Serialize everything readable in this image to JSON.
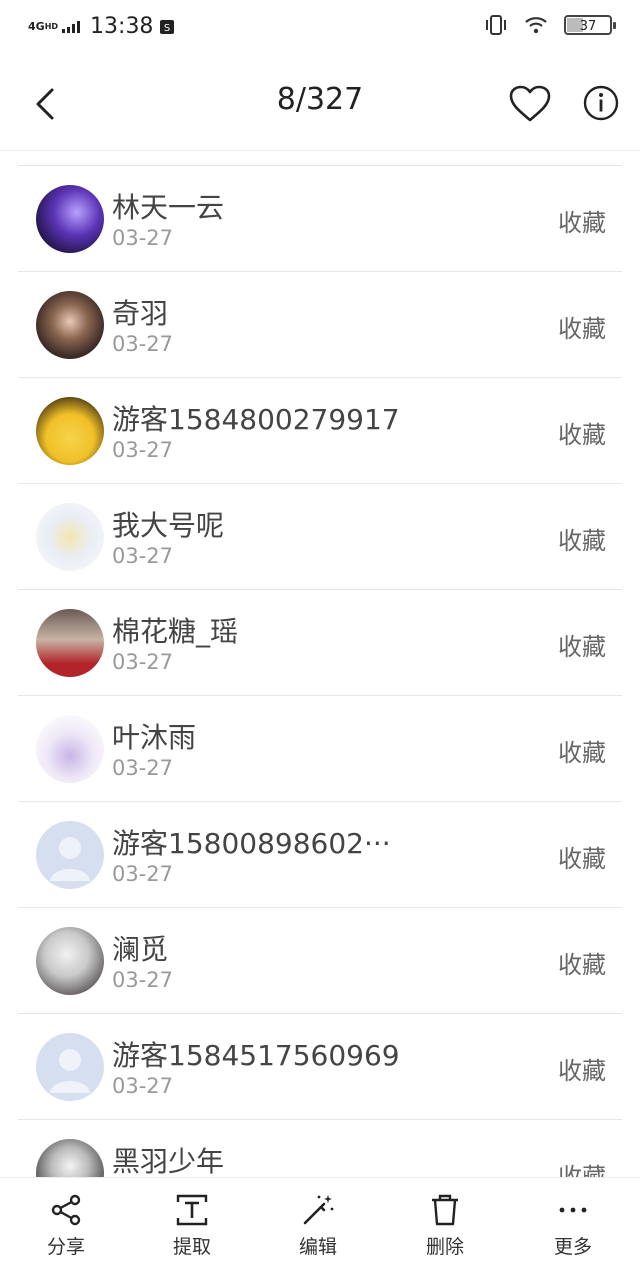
{
  "status_bar": {
    "network": "4G",
    "network_sup": "HD",
    "time": "13:38",
    "battery": "37"
  },
  "header": {
    "counter": "8/327"
  },
  "items": [
    {
      "name": "林天一云",
      "date": "03-27",
      "action": "收藏",
      "avatar": "purple-anime-avatar"
    },
    {
      "name": "奇羽",
      "date": "03-27",
      "action": "收藏",
      "avatar": "girl-photo-avatar"
    },
    {
      "name": "游客1584800279917",
      "date": "03-27",
      "action": "收藏",
      "avatar": "pikachu-avatar"
    },
    {
      "name": "我大号呢",
      "date": "03-27",
      "action": "收藏",
      "avatar": "anime-girl-avatar"
    },
    {
      "name": "棉花糖_瑶",
      "date": "03-27",
      "action": "收藏",
      "avatar": "group-photo-avatar"
    },
    {
      "name": "叶沐雨",
      "date": "03-27",
      "action": "收藏",
      "avatar": "sketch-avatar"
    },
    {
      "name": "游客15800898602···",
      "date": "03-27",
      "action": "收藏",
      "avatar": "default-avatar"
    },
    {
      "name": "澜觅",
      "date": "03-27",
      "action": "收藏",
      "avatar": "selfie-avatar"
    },
    {
      "name": "游客1584517560969",
      "date": "03-27",
      "action": "收藏",
      "avatar": "default-avatar"
    },
    {
      "name": "黑羽少年",
      "date": "",
      "action": "收藏",
      "avatar": "chibi-avatar"
    }
  ],
  "toolbar": {
    "share": "分享",
    "extract": "提取",
    "edit": "编辑",
    "delete": "删除",
    "more": "更多"
  },
  "colors": {
    "text": "#444444",
    "secondary": "#999999",
    "divider": "#e6e6e6"
  }
}
